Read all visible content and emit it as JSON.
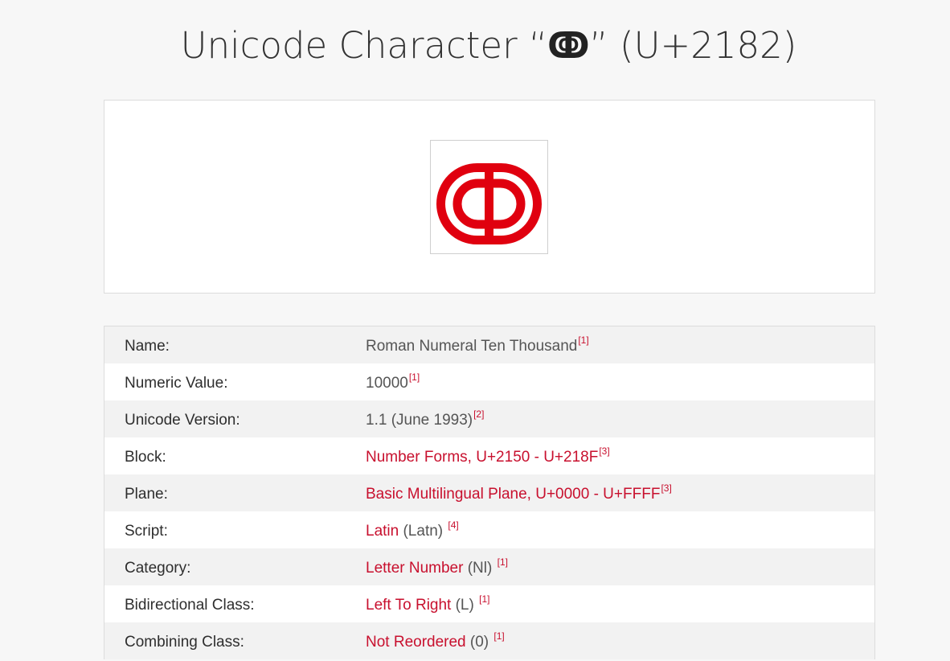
{
  "page": {
    "title_prefix": "Unicode Character “",
    "title_glyph": "ↂ",
    "title_suffix": "” (U+2182)",
    "accent_color": "#c8102e"
  },
  "glyph_preview": {
    "icon": "roman-numeral-ten-thousand-glyph",
    "color": "#e0000f"
  },
  "properties": [
    {
      "label": "Name:",
      "value": "Roman Numeral Ten Thousand",
      "value_is_link": false,
      "extra": "",
      "ref": "[1]"
    },
    {
      "label": "Numeric Value:",
      "value": "10000",
      "value_is_link": false,
      "extra": "",
      "ref": "[1]"
    },
    {
      "label": "Unicode Version:",
      "value": "1.1 (June 1993)",
      "value_is_link": false,
      "extra": "",
      "ref": "[2]"
    },
    {
      "label": "Block:",
      "value": "Number Forms, U+2150 - U+218F",
      "value_is_link": true,
      "extra": "",
      "ref": "[3]"
    },
    {
      "label": "Plane:",
      "value": "Basic Multilingual Plane, U+0000 - U+FFFF",
      "value_is_link": true,
      "extra": "",
      "ref": "[3]"
    },
    {
      "label": "Script:",
      "value": "Latin",
      "value_is_link": true,
      "extra": " (Latn) ",
      "ref": "[4]"
    },
    {
      "label": "Category:",
      "value": "Letter Number",
      "value_is_link": true,
      "extra": " (Nl) ",
      "ref": "[1]"
    },
    {
      "label": "Bidirectional Class:",
      "value": "Left To Right",
      "value_is_link": true,
      "extra": " (L) ",
      "ref": "[1]"
    },
    {
      "label": "Combining Class:",
      "value": "Not Reordered",
      "value_is_link": true,
      "extra": " (0) ",
      "ref": "[1]"
    }
  ]
}
